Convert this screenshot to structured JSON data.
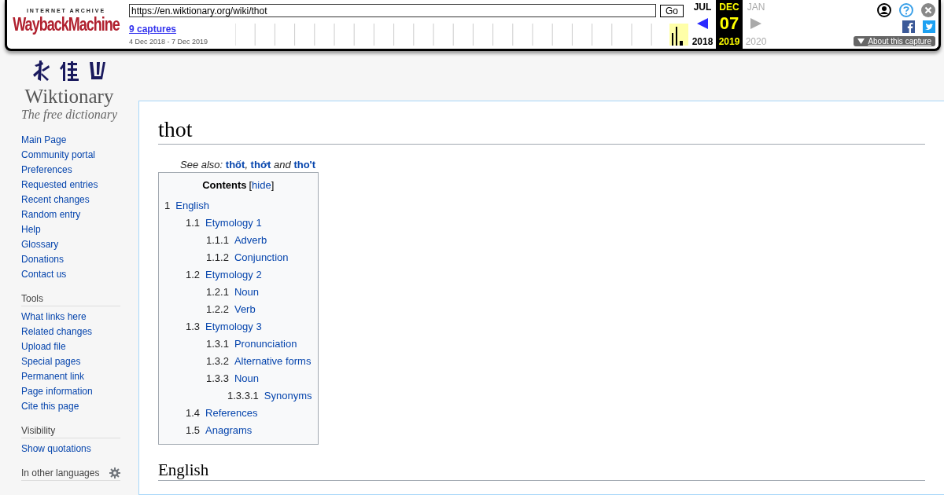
{
  "wayback": {
    "brand_top": "INTERNET ARCHIVE",
    "brand_main": "WaybackMachine",
    "url": "https://en.wiktionary.org/wiki/thot",
    "go": "Go",
    "captures": "9 captures",
    "range": "4 Dec 2018 - 7 Dec 2019",
    "months": [
      {
        "month": "JUL",
        "year": "2018",
        "selected": false,
        "available": true
      },
      {
        "month": "DEC",
        "day": "07",
        "year": "2019",
        "selected": true,
        "available": true
      },
      {
        "month": "JAN",
        "year": "2020",
        "selected": false,
        "available": false
      }
    ],
    "about": "About this capture"
  },
  "sidebar": {
    "logo_title": "Wiktionary",
    "logo_tagline": "The free dictionary",
    "sections": [
      {
        "items": [
          "Main Page",
          "Community portal",
          "Preferences",
          "Requested entries",
          "Recent changes",
          "Random entry",
          "Help",
          "Glossary",
          "Donations",
          "Contact us"
        ]
      },
      {
        "heading": "Tools",
        "items": [
          "What links here",
          "Related changes",
          "Upload file",
          "Special pages",
          "Permanent link",
          "Page information",
          "Cite this page"
        ]
      },
      {
        "heading": "Visibility",
        "items": [
          "Show quotations"
        ]
      },
      {
        "heading": "In other languages"
      }
    ]
  },
  "page": {
    "title": "thot",
    "see_also": "See also: **thốt**, **thớt** and **tho't**",
    "toc": {
      "title": "Contents",
      "hide_open": "[",
      "hide": "hide",
      "hide_close": "]",
      "items": [
        {
          "number": "1",
          "label": "English",
          "children": [
            {
              "number": "1.1",
              "label": "Etymology 1",
              "children": [
                {
                  "number": "1.1.1",
                  "label": "Adverb"
                },
                {
                  "number": "1.1.2",
                  "label": "Conjunction"
                }
              ]
            },
            {
              "number": "1.2",
              "label": "Etymology 2",
              "children": [
                {
                  "number": "1.2.1",
                  "label": "Noun"
                },
                {
                  "number": "1.2.2",
                  "label": "Verb"
                }
              ]
            },
            {
              "number": "1.3",
              "label": "Etymology 3",
              "children": [
                {
                  "number": "1.3.1",
                  "label": "Pronunciation"
                },
                {
                  "number": "1.3.2",
                  "label": "Alternative forms"
                },
                {
                  "number": "1.3.3",
                  "label": "Noun",
                  "children": [
                    {
                      "number": "1.3.3.1",
                      "label": "Synonyms"
                    }
                  ]
                }
              ]
            },
            {
              "number": "1.4",
              "label": "References"
            },
            {
              "number": "1.5",
              "label": "Anagrams"
            }
          ]
        }
      ]
    },
    "section_heading": "English"
  }
}
